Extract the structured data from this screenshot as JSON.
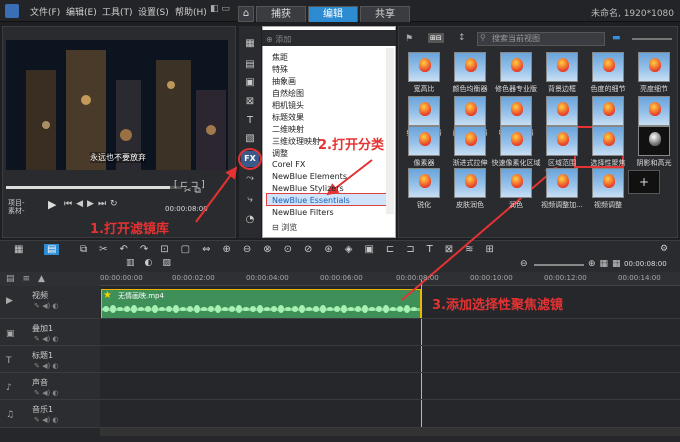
{
  "menu": {
    "file": "文件(F)",
    "edit": "编辑(E)",
    "tools": "工具(T)",
    "settings": "设置(S)",
    "help": "帮助(H)"
  },
  "tabs": [
    {
      "label": "捕获"
    },
    {
      "label": "编辑"
    },
    {
      "label": "共享"
    }
  ],
  "window_title": "未命名, 1920*1080",
  "preview": {
    "subtitle": "永远也不要放弃",
    "project_label": "项目-",
    "clip_label": "素材-",
    "timecode": "00:00:08:00"
  },
  "library": {
    "add_label": "添加",
    "browse_label": "浏览",
    "search_placeholder": "搜索当前视图"
  },
  "categories": [
    "焦距",
    "特殊",
    "抽象画",
    "自然绘图",
    "相机镜头",
    "标题效果",
    "二维映射",
    "三维纹理映射",
    "调整",
    "Corel FX",
    "NewBlue Elements",
    "NewBlue Stylizers",
    "NewBlue Essentials",
    "NewBlue Filters"
  ],
  "thumbnails": [
    [
      "宽高比",
      "颜色均衡器",
      "修色器专业版",
      "背景边框",
      "色度的细节",
      "亮度细节"
    ],
    [
      "细节增强器",
      "闪光消除器",
      "噪点校正器",
      "法定水平",
      "镜头校正",
      "降噪器"
    ],
    [
      "像素器",
      "渐进式拉伸",
      "快速像素化区域",
      "区域范围",
      "选择性聚焦",
      "阴影和高光"
    ],
    [
      "锐化",
      "皮肤润色",
      "润色",
      "视频调整加...",
      "视频调整",
      ""
    ]
  ],
  "timeline": {
    "timecode": "00:00:08:00",
    "ruler": [
      "00:00:00:00",
      "00:00:02:00",
      "00:00:04:00",
      "00:00:06:00",
      "00:00:08:00",
      "00:00:10:00",
      "00:00:12:00",
      "00:00:14:00"
    ],
    "tracks": [
      "视频",
      "叠加1",
      "标题1",
      "声音",
      "音乐1"
    ],
    "clip_name": "无情画映.mp4"
  },
  "annotations": {
    "step1": "1.打开滤镜库",
    "step2": "2.打开分类",
    "step3": "3.添加选择性聚焦滤镜"
  },
  "colors": {
    "accent": "#2d8bd1",
    "annotation": "#e53232",
    "clip": "#3f8f58"
  }
}
